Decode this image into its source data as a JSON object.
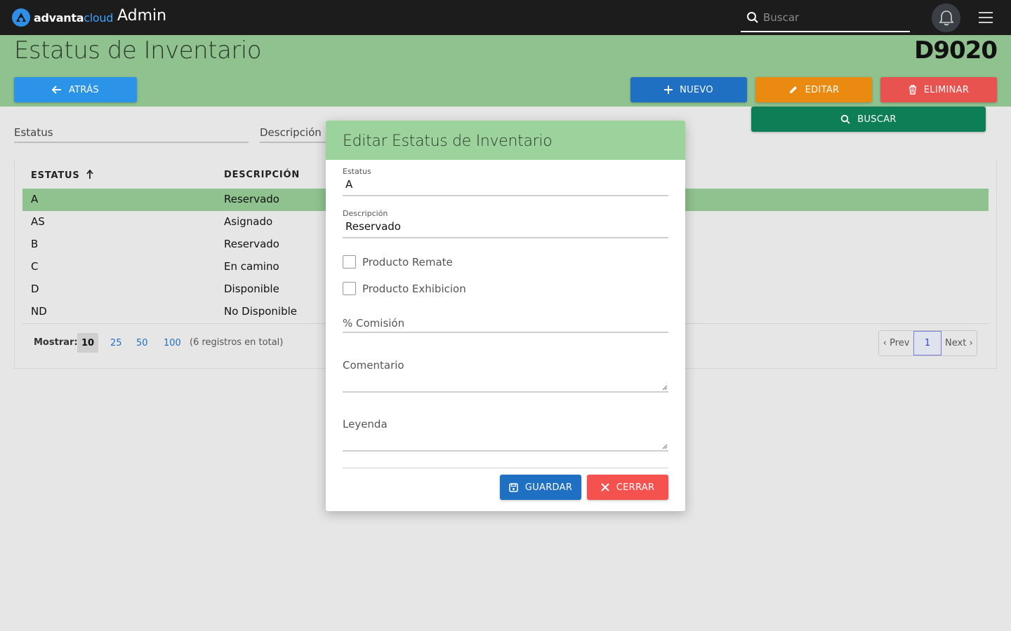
{
  "topbar": {
    "logo_main": "advanta",
    "logo_accent": "cloud",
    "app_title": "Admin",
    "search_placeholder": "Buscar"
  },
  "header": {
    "title": "Estatus de Inventario",
    "code": "D9020"
  },
  "actions": {
    "back": "ATRÁS",
    "new": "NUEVO",
    "edit": "EDITAR",
    "delete": "ELIMINAR",
    "search": "BUSCAR"
  },
  "filters": {
    "status": "Estatus",
    "description": "Descripción"
  },
  "table": {
    "columns": [
      "ESTATUS",
      "DESCRIPCIÓN"
    ],
    "rows": [
      {
        "status": "A",
        "description": "Reservado"
      },
      {
        "status": "AS",
        "description": "Asignado"
      },
      {
        "status": "B",
        "description": "Reservado"
      },
      {
        "status": "C",
        "description": "En camino"
      },
      {
        "status": "D",
        "description": "Disponible"
      },
      {
        "status": "ND",
        "description": "No Disponible"
      }
    ]
  },
  "pagination": {
    "show_label": "Mostrar:",
    "sizes": [
      "10",
      "25",
      "50",
      "100"
    ],
    "total": "(6 registros en total)",
    "prev": "‹ Prev",
    "page": "1",
    "next": "Next ›"
  },
  "modal": {
    "title": "Editar Estatus de Inventario",
    "status_label": "Estatus",
    "status_value": "A",
    "description_label": "Descripción",
    "description_value": "Reservado",
    "checkbox_remate": "Producto Remate",
    "checkbox_exhibicion": "Producto Exhibicion",
    "commission_label": "% Comisión",
    "comment_label": "Comentario",
    "legend_label": "Leyenda",
    "save": "GUARDAR",
    "close": "CERRAR"
  },
  "colors": {
    "topbar": "#1c1c1c",
    "header_green": "#8fc28f",
    "modal_header": "#9cd29c",
    "primary": "#1f6fc2",
    "warning": "#ea8a10",
    "danger": "#e8534f",
    "success": "#0d7e55"
  }
}
